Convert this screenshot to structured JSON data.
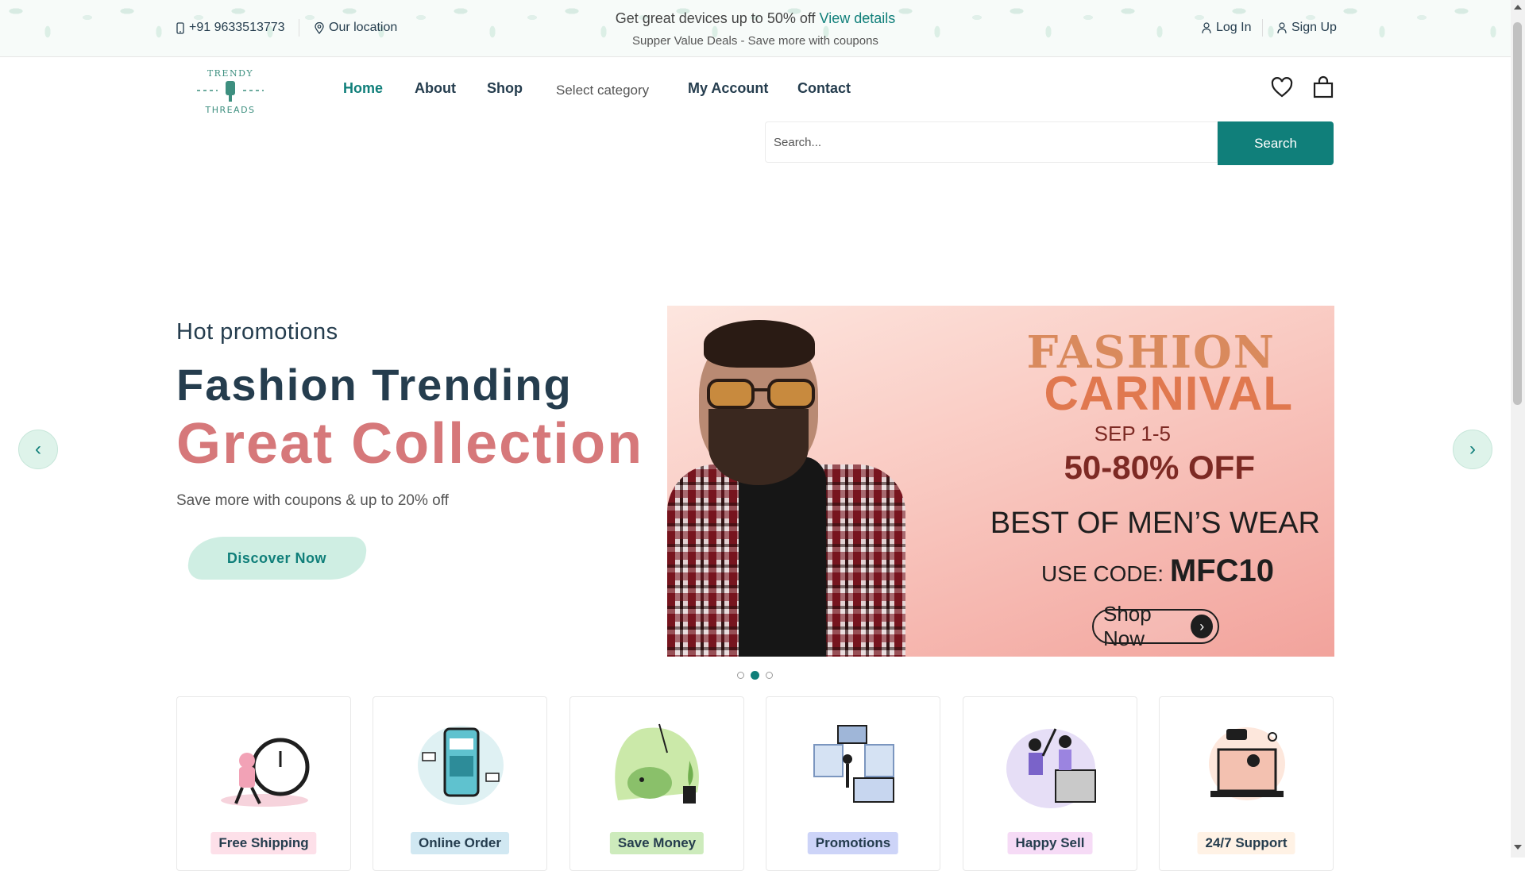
{
  "topbar": {
    "phone": "+91 9633513773",
    "location": "Our location",
    "promo_text": "Get great devices up to 50% off",
    "promo_link": "View details",
    "promo_sub": "Supper Value Deals - Save more with coupons",
    "login": "Log In",
    "signup": "Sign Up"
  },
  "logo": {
    "top_text": "TRENDY",
    "bottom_text": "THREADS"
  },
  "nav": {
    "home": "Home",
    "about": "About",
    "shop": "Shop",
    "category": "Select category",
    "account": "My Account",
    "contact": "Contact"
  },
  "search": {
    "placeholder": "Search...",
    "button": "Search"
  },
  "hero": {
    "subtitle": "Hot promotions",
    "title1": "Fashion Trending",
    "title2": "Great Collection",
    "text": "Save more with coupons & up to 20% off",
    "cta": "Discover Now"
  },
  "banner": {
    "line1": "FASHION",
    "line2": "CARNIVAL",
    "dates": "SEP 1-5",
    "discount": "50-80% OFF",
    "headline": "BEST OF MEN’S WEAR",
    "code_label": "USE CODE:",
    "code": "MFC10",
    "cta": "Shop Now"
  },
  "slider": {
    "active_index": 2,
    "total": 3
  },
  "features": [
    {
      "label": "Free Shipping",
      "bg": "#fde0e9",
      "color": "#253d4e"
    },
    {
      "label": "Online Order",
      "bg": "#d1e8f2",
      "color": "#253d4e"
    },
    {
      "label": "Save Money",
      "bg": "#cdebbc",
      "color": "#253d4e"
    },
    {
      "label": "Promotions",
      "bg": "#cdd4f8",
      "color": "#253d4e"
    },
    {
      "label": "Happy Sell",
      "bg": "#f6dbf6",
      "color": "#253d4e"
    },
    {
      "label": "24/7 Support",
      "bg": "#fff2e5",
      "color": "#253d4e"
    }
  ],
  "colors": {
    "brand": "#107f7a",
    "accent": "#d6787a"
  }
}
